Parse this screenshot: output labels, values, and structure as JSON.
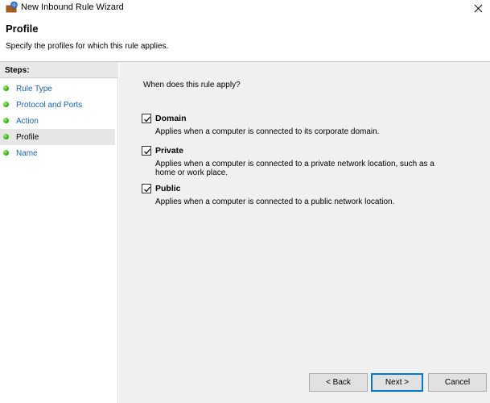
{
  "window": {
    "title": "New Inbound Rule Wizard"
  },
  "header": {
    "title": "Profile",
    "subtitle": "Specify the profiles for which this rule applies."
  },
  "sidebar": {
    "heading": "Steps:",
    "items": [
      {
        "label": "Rule Type",
        "active": false
      },
      {
        "label": "Protocol and Ports",
        "active": false
      },
      {
        "label": "Action",
        "active": false
      },
      {
        "label": "Profile",
        "active": true
      },
      {
        "label": "Name",
        "active": false
      }
    ]
  },
  "main": {
    "question": "When does this rule apply?",
    "options": [
      {
        "label": "Domain",
        "checked": true,
        "description": "Applies when a computer is connected to its corporate domain."
      },
      {
        "label": "Private",
        "checked": true,
        "description": "Applies when a computer is connected to a private network location, such as a home or work place."
      },
      {
        "label": "Public",
        "checked": true,
        "description": "Applies when a computer is connected to a public network location."
      }
    ]
  },
  "buttons": {
    "back": "< Back",
    "next": "Next >",
    "cancel": "Cancel"
  },
  "colors": {
    "link": "#1560bd",
    "content_bg": "#f0f0f0",
    "step_dot": "#33b11a"
  }
}
